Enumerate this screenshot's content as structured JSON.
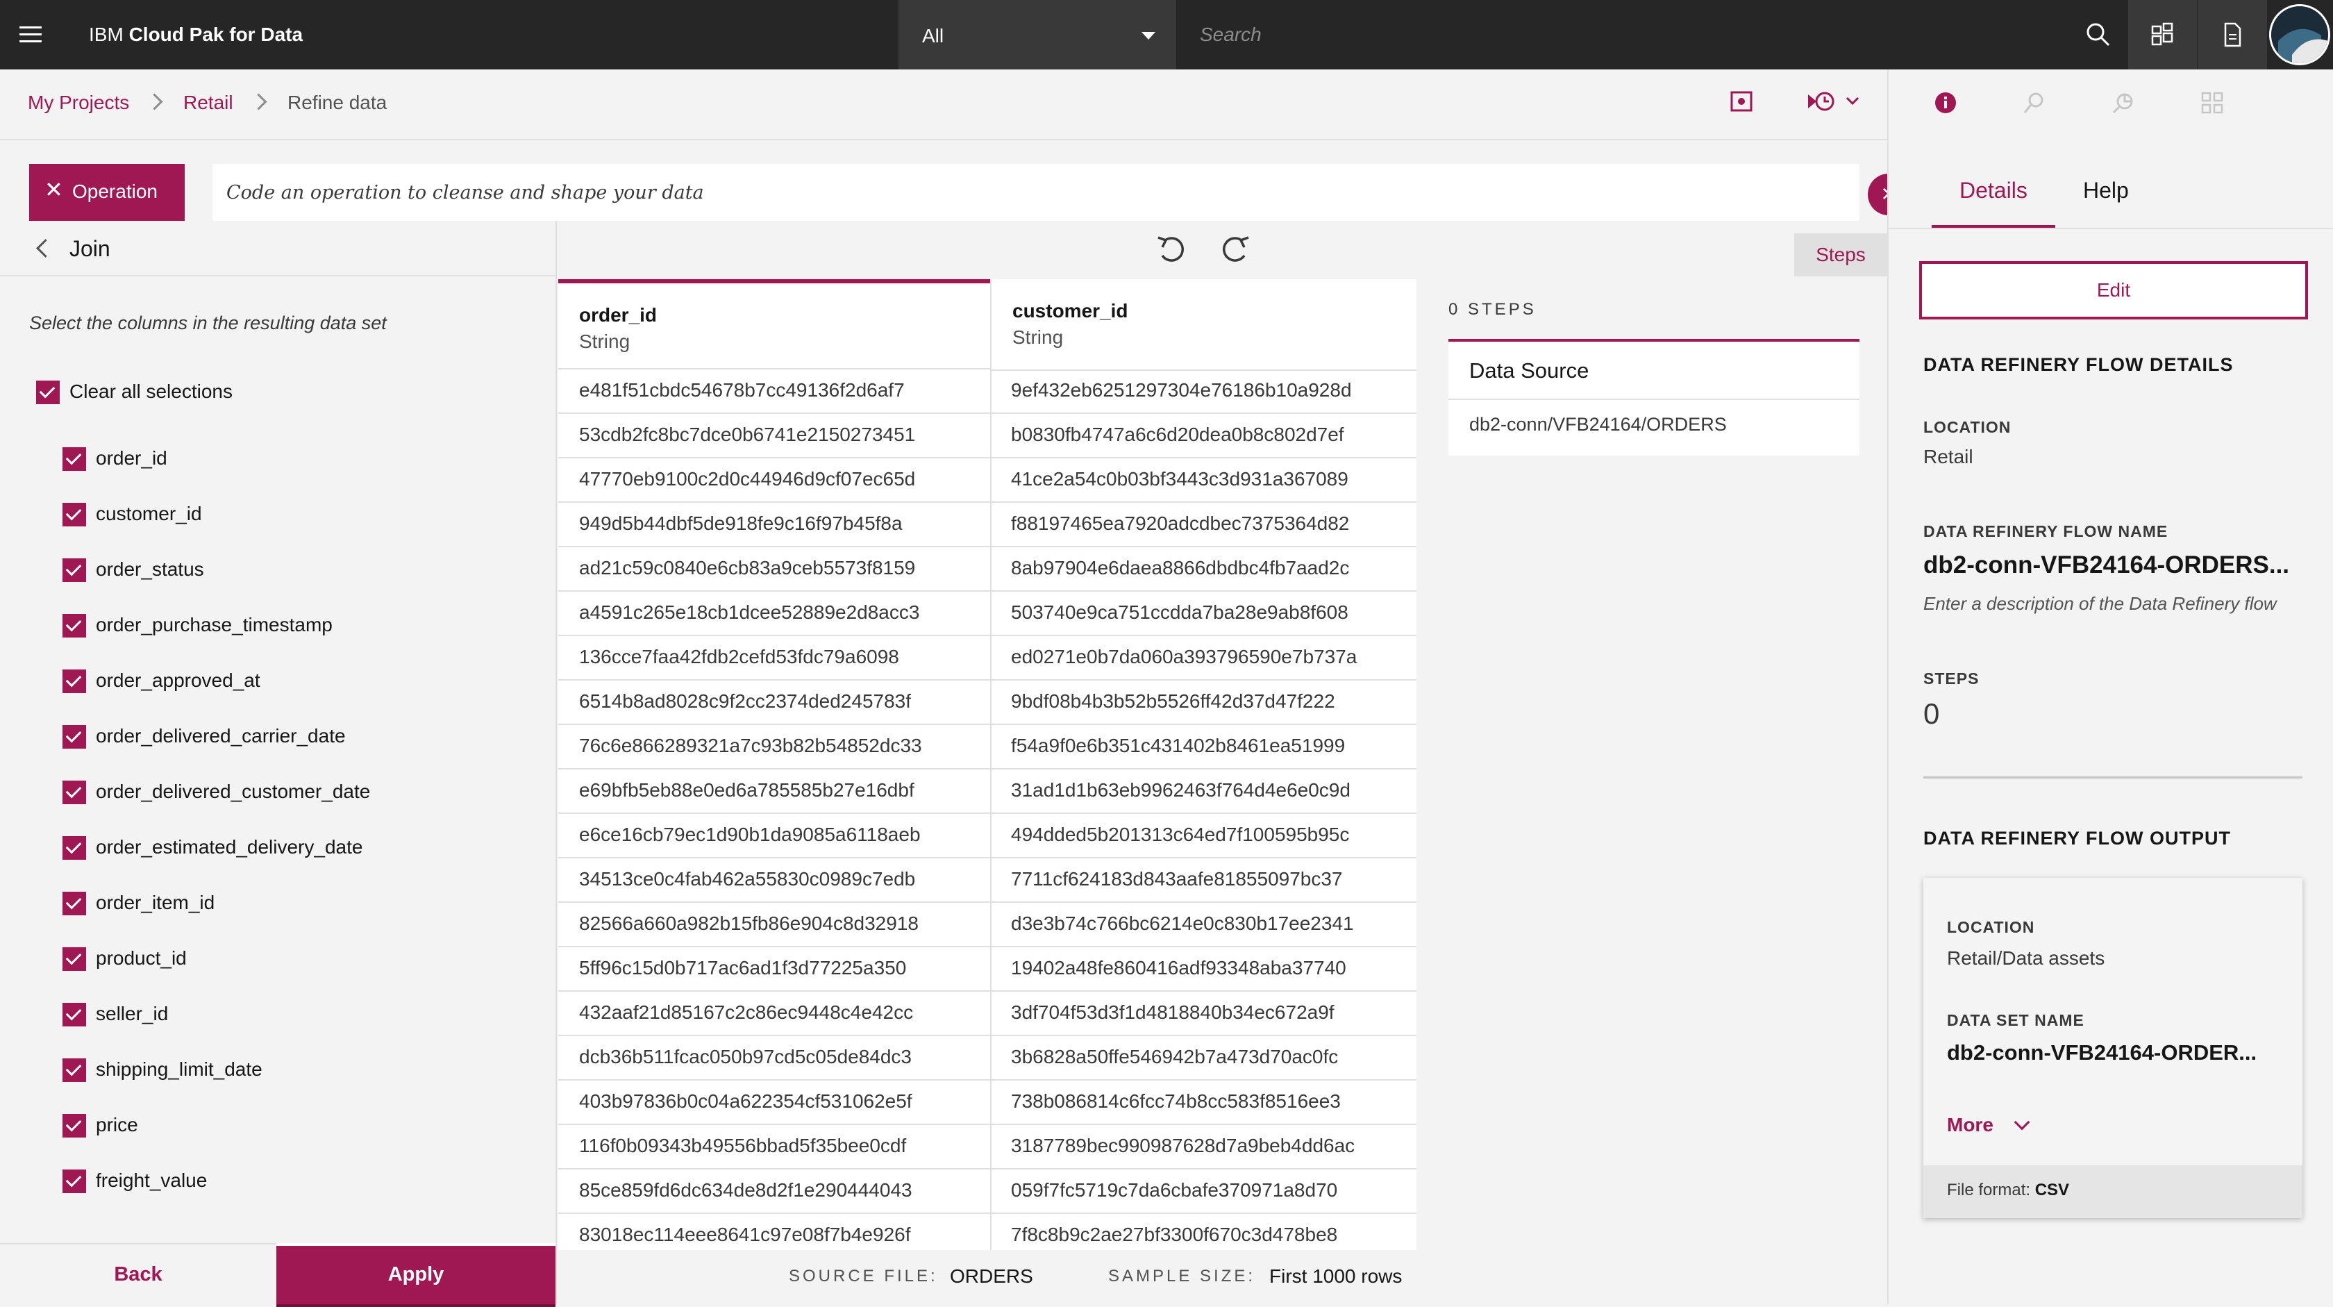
{
  "header": {
    "brand_prefix": "IBM",
    "brand_name": "Cloud Pak for Data",
    "scope_value": "All",
    "search_placeholder": "Search"
  },
  "breadcrumb": [
    "My Projects",
    "Retail",
    "Refine data"
  ],
  "operation": {
    "button_label": "Operation",
    "code_placeholder": "Code an operation to cleanse and shape your data"
  },
  "join_panel": {
    "title": "Join",
    "instructions": "Select the columns in the resulting data set",
    "clear_all": "Clear all selections",
    "columns": [
      "order_id",
      "customer_id",
      "order_status",
      "order_purchase_timestamp",
      "order_approved_at",
      "order_delivered_carrier_date",
      "order_delivered_customer_date",
      "order_estimated_delivery_date",
      "order_item_id",
      "product_id",
      "seller_id",
      "shipping_limit_date",
      "price",
      "freight_value"
    ],
    "back_label": "Back",
    "apply_label": "Apply"
  },
  "table": {
    "columns": [
      {
        "name": "order_id",
        "type": "String"
      },
      {
        "name": "customer_id",
        "type": "String"
      }
    ],
    "rows": [
      [
        "e481f51cbdc54678b7cc49136f2d6af7",
        "9ef432eb6251297304e76186b10a928d"
      ],
      [
        "53cdb2fc8bc7dce0b6741e2150273451",
        "b0830fb4747a6c6d20dea0b8c802d7ef"
      ],
      [
        "47770eb9100c2d0c44946d9cf07ec65d",
        "41ce2a54c0b03bf3443c3d931a367089"
      ],
      [
        "949d5b44dbf5de918fe9c16f97b45f8a",
        "f88197465ea7920adcdbec7375364d82"
      ],
      [
        "ad21c59c0840e6cb83a9ceb5573f8159",
        "8ab97904e6daea8866dbdbc4fb7aad2c"
      ],
      [
        "a4591c265e18cb1dcee52889e2d8acc3",
        "503740e9ca751ccdda7ba28e9ab8f608"
      ],
      [
        "136cce7faa42fdb2cefd53fdc79a6098",
        "ed0271e0b7da060a393796590e7b737a"
      ],
      [
        "6514b8ad8028c9f2cc2374ded245783f",
        "9bdf08b4b3b52b5526ff42d37d47f222"
      ],
      [
        "76c6e866289321a7c93b82b54852dc33",
        "f54a9f0e6b351c431402b8461ea51999"
      ],
      [
        "e69bfb5eb88e0ed6a785585b27e16dbf",
        "31ad1d1b63eb9962463f764d4e6e0c9d"
      ],
      [
        "e6ce16cb79ec1d90b1da9085a6118aeb",
        "494dded5b201313c64ed7f100595b95c"
      ],
      [
        "34513ce0c4fab462a55830c0989c7edb",
        "7711cf624183d843aafe81855097bc37"
      ],
      [
        "82566a660a982b15fb86e904c8d32918",
        "d3e3b74c766bc6214e0c830b17ee2341"
      ],
      [
        "5ff96c15d0b717ac6ad1f3d77225a350",
        "19402a48fe860416adf93348aba37740"
      ],
      [
        "432aaf21d85167c2c86ec9448c4e42cc",
        "3df704f53d3f1d4818840b34ec672a9f"
      ],
      [
        "dcb36b511fcac050b97cd5c05de84dc3",
        "3b6828a50ffe546942b7a473d70ac0fc"
      ],
      [
        "403b97836b0c04a622354cf531062e5f",
        "738b086814c6fcc74b8cc583f8516ee3"
      ],
      [
        "116f0b09343b49556bbad5f35bee0cdf",
        "3187789bec990987628d7a9beb4dd6ac"
      ],
      [
        "85ce859fd6dc634de8d2f1e290444043",
        "059f7fc5719c7da6cbafe370971a8d70"
      ],
      [
        "83018ec114eee8641c97e08f7b4e926f",
        "7f8c8b9c2ae27bf3300f670c3d478be8"
      ]
    ],
    "source_file_label": "SOURCE FILE:",
    "source_file_value": "ORDERS",
    "sample_size_label": "SAMPLE SIZE:",
    "sample_size_value": "First 1000 rows"
  },
  "steps": {
    "tab_label": "Steps",
    "count_label": "0 STEPS",
    "data_source_title": "Data Source",
    "data_source_path": "db2-conn/VFB24164/ORDERS"
  },
  "details": {
    "tabs": [
      "Details",
      "Help"
    ],
    "edit_label": "Edit",
    "flow_details_title": "DATA REFINERY FLOW DETAILS",
    "location_label": "LOCATION",
    "location_value": "Retail",
    "flow_name_label": "DATA REFINERY FLOW NAME",
    "flow_name_value": "db2-conn-VFB24164-ORDERS...",
    "description_placeholder": "Enter a description of the Data Refinery flow",
    "steps_label": "STEPS",
    "steps_value": "0",
    "output_title": "DATA REFINERY FLOW OUTPUT",
    "output_location_label": "LOCATION",
    "output_location_value": "Retail/Data assets",
    "dataset_name_label": "DATA SET NAME",
    "dataset_name_value": "db2-conn-VFB24164-ORDER...",
    "more_label": "More",
    "file_format_label": "File format:",
    "file_format_value": "CSV"
  },
  "colors": {
    "accent": "#9f1853",
    "topbar": "#262626"
  }
}
